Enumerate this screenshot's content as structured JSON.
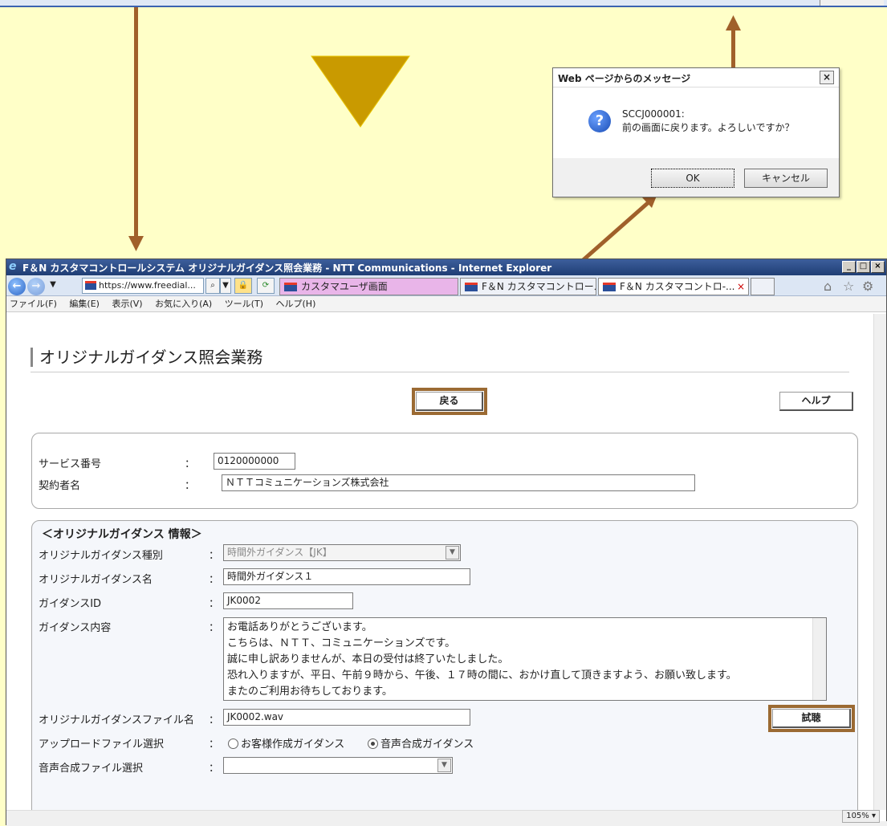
{
  "dialog": {
    "title": "Web ページからのメッセージ",
    "close": "×",
    "code": "SCCJ000001:",
    "message": "前の画面に戻ります。よろしいですか？",
    "ok": "OK",
    "cancel": "キャンセル"
  },
  "browser": {
    "title": "F＆N カスタマコントロールシステム オリジナルガイダンス照会業務 - NTT Communications - Internet Explorer",
    "address": "https://www.freedial...",
    "tabs": [
      "カスタマユーザ画面",
      "F＆N カスタマコントロール...",
      "F＆N カスタマコントロ-..."
    ],
    "menu": [
      "ファイル(F)",
      "編集(E)",
      "表示(V)",
      "お気に入り(A)",
      "ツール(T)",
      "ヘルプ(H)"
    ],
    "zoom": "105%"
  },
  "page": {
    "title": "オリジナルガイダンス照会業務",
    "back_button": "戻る",
    "help_button": "ヘルプ",
    "service_number_label": "サービス番号",
    "service_number": "0120000000",
    "contractor_label": "契約者名",
    "contractor": "ＮＴＴコミュニケーションズ株式会社",
    "section_title": "＜オリジナルガイダンス 情報＞",
    "type_label": "オリジナルガイダンス種別",
    "type_value": "時間外ガイダンス【JK】",
    "name_label": "オリジナルガイダンス名",
    "name_value": "時間外ガイダンス１",
    "id_label": "ガイダンスID",
    "id_value": "JK0002",
    "content_label": "ガイダンス内容",
    "content_lines": [
      "お電話ありがとうございます。",
      "こちらは、ＮＴＴ、コミュニケーションズです。",
      "誠に申し訳ありませんが、本日の受付は終了いたしました。",
      "恐れ入りますが、平日、午前９時から、午後、１７時の間に、おかけ直して頂きますよう、お願い致します。",
      "またのご利用お待ちしております。"
    ],
    "file_label": "オリジナルガイダンスファイル名",
    "file_value": "JK0002.wav",
    "listen_button": "試聴",
    "upload_label": "アップロードファイル選択",
    "upload_opt1": "お客様作成ガイダンス",
    "upload_opt2": "音声合成ガイダンス",
    "synth_label": "音声合成ファイル選択",
    "synth_value": "",
    "colon": "："
  }
}
